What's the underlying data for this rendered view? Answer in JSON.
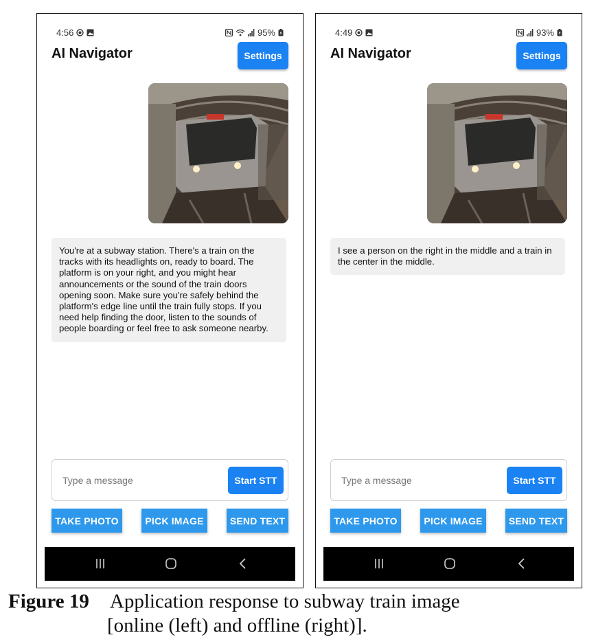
{
  "phones": [
    {
      "status": {
        "time": "4:56",
        "battery": "95%"
      },
      "app_title": "AI Navigator",
      "settings_label": "Settings",
      "response": "You're at a subway station. There's a train on the tracks with its headlights on, ready to board. The platform is on your right, and you might hear announcements or the sound of the train doors opening soon. Make sure you're safely behind the platform's edge line until the train fully stops. If you need help finding the door, listen to the sounds of people boarding or feel free to ask someone nearby.",
      "input_placeholder": "Type a message",
      "stt_label": "Start STT",
      "buttons": {
        "take_photo": "TAKE PHOTO",
        "pick_image": "PICK IMAGE",
        "send_text": "SEND TEXT"
      }
    },
    {
      "status": {
        "time": "4:49",
        "battery": "93%"
      },
      "app_title": "AI Navigator",
      "settings_label": "Settings",
      "response": "I see a person on the right in the middle and a train in the center in the middle.",
      "input_placeholder": "Type a message",
      "stt_label": "Start STT",
      "buttons": {
        "take_photo": "TAKE PHOTO",
        "pick_image": "PICK IMAGE",
        "send_text": "SEND TEXT"
      }
    }
  ],
  "caption": {
    "label": "Figure 19",
    "text_line1": "Application response to subway train image",
    "text_line2": "[online (left) and offline (right)]."
  },
  "colors": {
    "accent": "#1a82f2",
    "action_button": "#2d98ec",
    "bubble": "#f0f0f0",
    "navbar": "#000000"
  }
}
